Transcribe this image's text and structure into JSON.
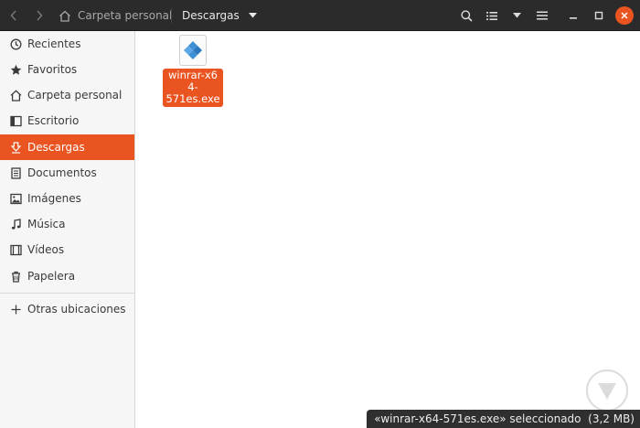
{
  "header": {
    "breadcrumb_home": "Carpeta personal",
    "breadcrumb_current": "Descargas"
  },
  "sidebar": {
    "items": [
      {
        "label": "Recientes",
        "icon": "clock-icon"
      },
      {
        "label": "Favoritos",
        "icon": "star-icon"
      },
      {
        "label": "Carpeta personal",
        "icon": "home-icon"
      },
      {
        "label": "Escritorio",
        "icon": "desktop-icon"
      },
      {
        "label": "Descargas",
        "icon": "download-icon",
        "active": true
      },
      {
        "label": "Documentos",
        "icon": "document-icon"
      },
      {
        "label": "Imágenes",
        "icon": "image-icon"
      },
      {
        "label": "Música",
        "icon": "music-icon"
      },
      {
        "label": "Vídeos",
        "icon": "video-icon"
      },
      {
        "label": "Papelera",
        "icon": "trash-icon"
      }
    ],
    "other_locations": "Otras ubicaciones"
  },
  "main": {
    "files": [
      {
        "name": "winrar-x64-571es.exe",
        "name_line1": "winrar-x64-",
        "name_line2": "571es.exe",
        "selected": true
      }
    ]
  },
  "status": {
    "text": "«winrar-x64-571es.exe» seleccionado  (3,2 MB)"
  },
  "colors": {
    "accent": "#e95420",
    "header_bg": "#2b2b2b",
    "sidebar_bg": "#f6f6f6"
  }
}
